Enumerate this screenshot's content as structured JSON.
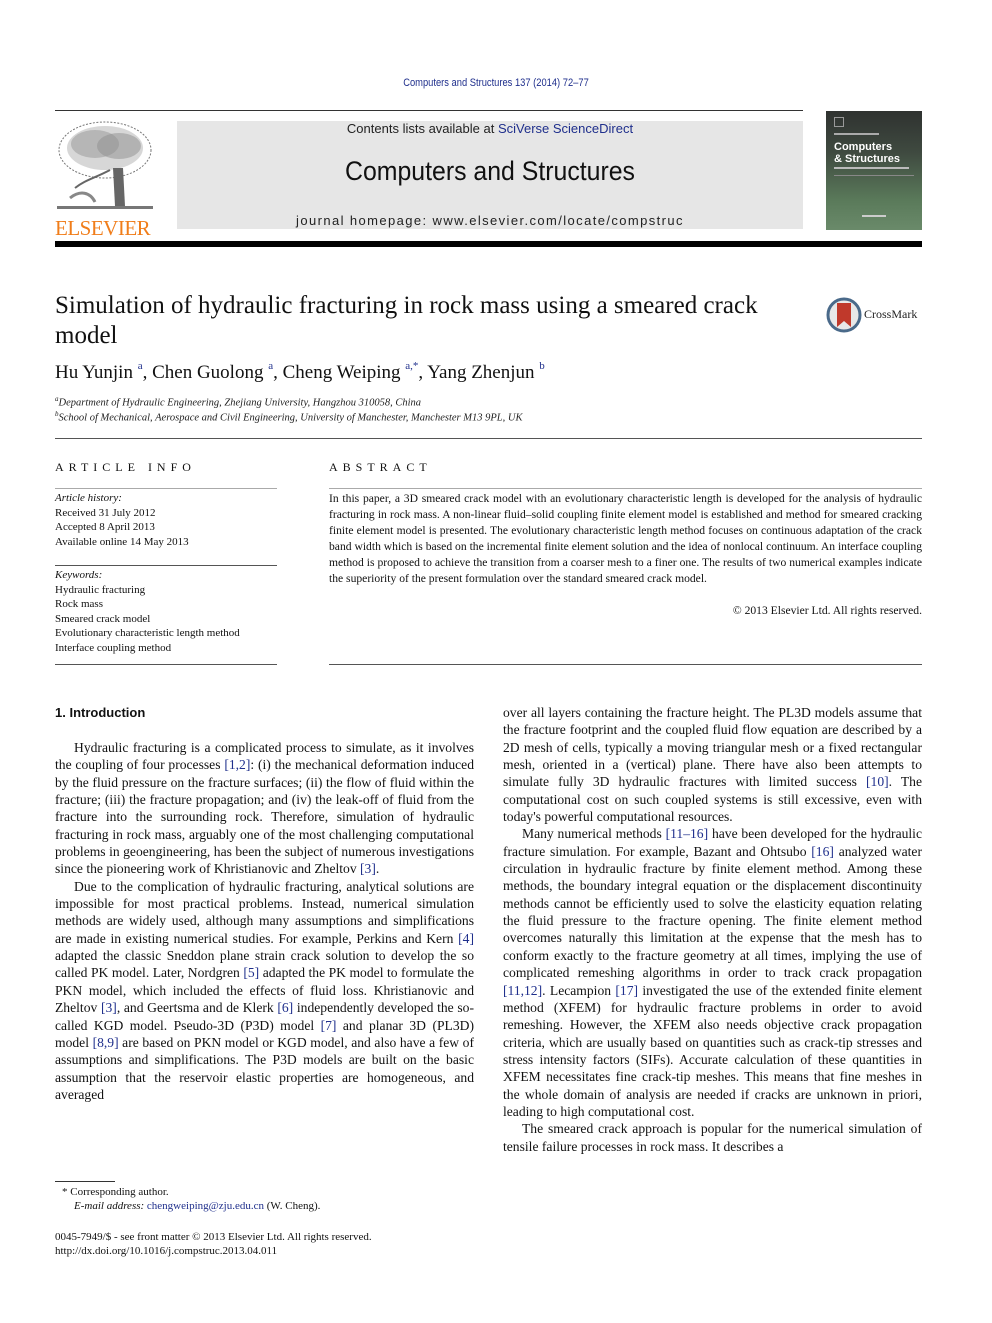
{
  "header": {
    "journal_reference": "Computers and Structures 137 (2014) 72–77",
    "contents_prefix": "Contents lists available at ",
    "contents_link": "SciVerse ScienceDirect",
    "journal_name": "Computers and Structures",
    "homepage_prefix": "journal homepage: ",
    "homepage_url": "www.elsevier.com/locate/compstruc",
    "publisher_logo_text": "ELSEVIER",
    "cover": {
      "title_line1": "Computers",
      "title_line2": "& Structures"
    }
  },
  "colors": {
    "link": "#1f2f8c",
    "elsevier_orange": "#f07d1a",
    "header_band": "#e6e6e6",
    "crossmark_red": "#c0392b"
  },
  "article": {
    "title": "Simulation of hydraulic fracturing in rock mass using a smeared crack model",
    "crossmark_label": "CrossMark",
    "authors": [
      {
        "name": "Hu Yunjin",
        "sup": "a",
        "sep": ", "
      },
      {
        "name": "Chen Guolong",
        "sup": "a",
        "sep": ", "
      },
      {
        "name": "Cheng Weiping",
        "sup": "a,*",
        "sep": ", "
      },
      {
        "name": "Yang Zhenjun",
        "sup": "b",
        "sep": ""
      }
    ],
    "affiliations": [
      {
        "sup": "a",
        "text": "Department of Hydraulic Engineering, Zhejiang University, Hangzhou 310058, China"
      },
      {
        "sup": "b",
        "text": "School of Mechanical, Aerospace and Civil Engineering, University of Manchester, Manchester M13 9PL, UK"
      }
    ]
  },
  "article_info": {
    "heading": "ARTICLE INFO",
    "history_label": "Article history:",
    "history": [
      "Received 31 July 2012",
      "Accepted 8 April 2013",
      "Available online 14 May 2013"
    ],
    "keywords_label": "Keywords:",
    "keywords": [
      "Hydraulic fracturing",
      "Rock mass",
      "Smeared crack model",
      "Evolutionary characteristic length method",
      "Interface coupling method"
    ]
  },
  "abstract": {
    "heading": "ABSTRACT",
    "text": "In this paper, a 3D smeared crack model with an evolutionary characteristic length is developed for the analysis of hydraulic fracturing in rock mass. A non-linear fluid–solid coupling finite element model is established and method for smeared cracking finite element model is presented. The evolutionary characteristic length method focuses on continuous adaptation of the crack band width which is based on the incremental finite element solution and the idea of nonlocal continuum. An interface coupling method is proposed to achieve the transition from a coarser mesh to a finer one. The results of two numerical examples indicate the superiority of the present formulation over the standard smeared crack model.",
    "copyright": "© 2013 Elsevier Ltd. All rights reserved."
  },
  "body": {
    "section_heading": "1. Introduction",
    "left_paragraphs": [
      [
        {
          "t": "Hydraulic fracturing is a complicated process to simulate, as it involves the coupling of four processes "
        },
        {
          "ref": "[1,2]"
        },
        {
          "t": ": (i) the mechanical deformation induced by the fluid pressure on the fracture surfaces; (ii) the flow of fluid within the fracture; (iii) the fracture propagation; and (iv) the leak-off of fluid from the fracture into the surrounding rock. Therefore, simulation of hydraulic fracturing in rock mass, arguably one of the most challenging computational problems in geoengineering, has been the subject of numerous investigations since the pioneering work of Khristianovic and Zheltov "
        },
        {
          "ref": "[3]"
        },
        {
          "t": "."
        }
      ],
      [
        {
          "t": "Due to the complication of hydraulic fracturing, analytical solutions are impossible for most practical problems. Instead, numerical simulation methods are widely used, although many assumptions and simplifications are made in existing numerical studies. For example, Perkins and Kern "
        },
        {
          "ref": "[4]"
        },
        {
          "t": " adapted the classic Sneddon plane strain crack solution to develop the so called PK model. Later, Nordgren "
        },
        {
          "ref": "[5]"
        },
        {
          "t": " adapted the PK model to formulate the PKN model, which included the effects of fluid loss. Khristianovic and Zheltov "
        },
        {
          "ref": "[3]"
        },
        {
          "t": ", and Geertsma and de Klerk "
        },
        {
          "ref": "[6]"
        },
        {
          "t": " independently developed the so-called KGD model. Pseudo-3D (P3D) model "
        },
        {
          "ref": "[7]"
        },
        {
          "t": " and planar 3D (PL3D) model "
        },
        {
          "ref": "[8,9]"
        },
        {
          "t": " are based on PKN model or KGD model, and also have a few of assumptions and simplifications. The P3D models are built on the basic assumption that the reservoir elastic properties are homogeneous, and averaged"
        }
      ]
    ],
    "right_paragraphs": [
      [
        {
          "t": "over all layers containing the fracture height. The PL3D models assume that the fracture footprint and the coupled fluid flow equation are described by a 2D mesh of cells, typically a moving triangular mesh or a fixed rectangular mesh, oriented in a (vertical) plane. There have also been attempts to simulate fully 3D hydraulic fractures with limited success "
        },
        {
          "ref": "[10]"
        },
        {
          "t": ". The computational cost on such coupled systems is still excessive, even with today's powerful computational resources."
        }
      ],
      [
        {
          "t": "Many numerical methods "
        },
        {
          "ref": "[11–16]"
        },
        {
          "t": " have been developed for the hydraulic fracture simulation. For example, Bazant and Ohtsubo "
        },
        {
          "ref": "[16]"
        },
        {
          "t": " analyzed water circulation in hydraulic fracture by finite element method. Among these methods, the boundary integral equation or the displacement discontinuity methods cannot be efficiently used to solve the elasticity equation relating the fluid pressure to the fracture opening. The finite element method overcomes naturally this limitation at the expense that the mesh has to conform exactly to the fracture geometry at all times, implying the use of complicated remeshing algorithms in order to track crack propagation "
        },
        {
          "ref": "[11,12]"
        },
        {
          "t": ". Lecampion "
        },
        {
          "ref": "[17]"
        },
        {
          "t": " investigated the use of the extended finite element method (XFEM) for hydraulic fracture problems in order to avoid remeshing. However, the XFEM also needs objective crack propagation criteria, which are usually based on quantities such as crack-tip stresses and stress intensity factors (SIFs). Accurate calculation of these quantities in XFEM necessitates fine crack-tip meshes. This means that fine meshes in the whole domain of analysis are needed if cracks are unknown in priori, leading to high computational cost."
        }
      ],
      [
        {
          "t": "The smeared crack approach is popular for the numerical simulation of tensile failure processes in rock mass. It describes a"
        }
      ]
    ]
  },
  "footnotes": {
    "corresponding_mark": "*",
    "corresponding_text": "Corresponding author.",
    "email_label": "E-mail address:",
    "email": "chengweiping@zju.edu.cn",
    "email_suffix": " (W. Cheng).",
    "issn_line": "0045-7949/$ - see front matter © 2013 Elsevier Ltd. All rights reserved.",
    "doi": "http://dx.doi.org/10.1016/j.compstruc.2013.04.011"
  }
}
